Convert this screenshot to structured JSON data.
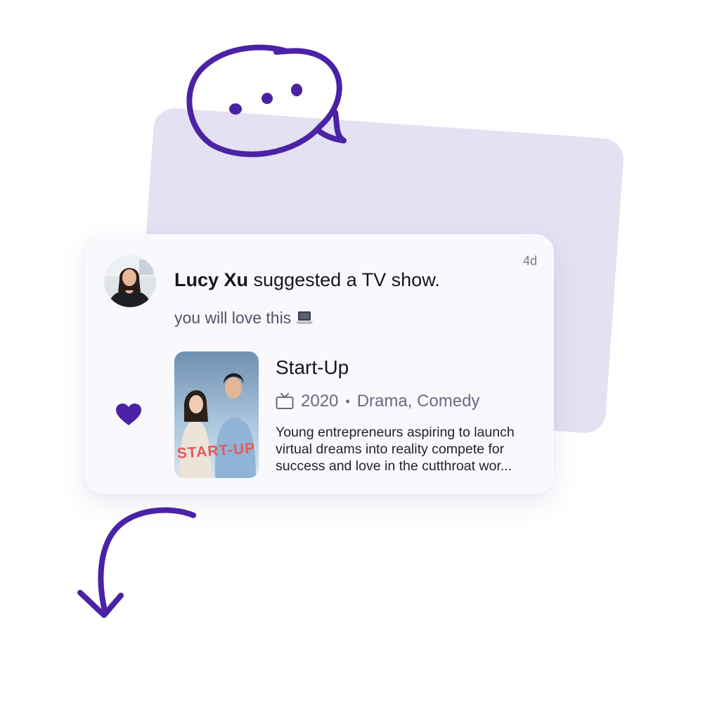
{
  "post": {
    "user_name": "Lucy Xu",
    "action_text": " suggested a TV show.",
    "time_ago": "4d",
    "message": "you will love this",
    "message_icon": "laptop-icon"
  },
  "show": {
    "title": "Start-Up",
    "year": "2020",
    "separator": "•",
    "genres": "Drama, Comedy",
    "description_lines": [
      "Young entrepreneurs aspiring to launch",
      "virtual dreams into reality compete for",
      "success and love in the cutthroat wor..."
    ],
    "poster_title": "START-UP",
    "type_icon": "tv-icon"
  },
  "reaction": {
    "icon": "heart-icon",
    "liked": true
  },
  "colors": {
    "accent": "#4b22a5",
    "background_card": "#e3e1f2",
    "card": "#f8f8fd"
  }
}
